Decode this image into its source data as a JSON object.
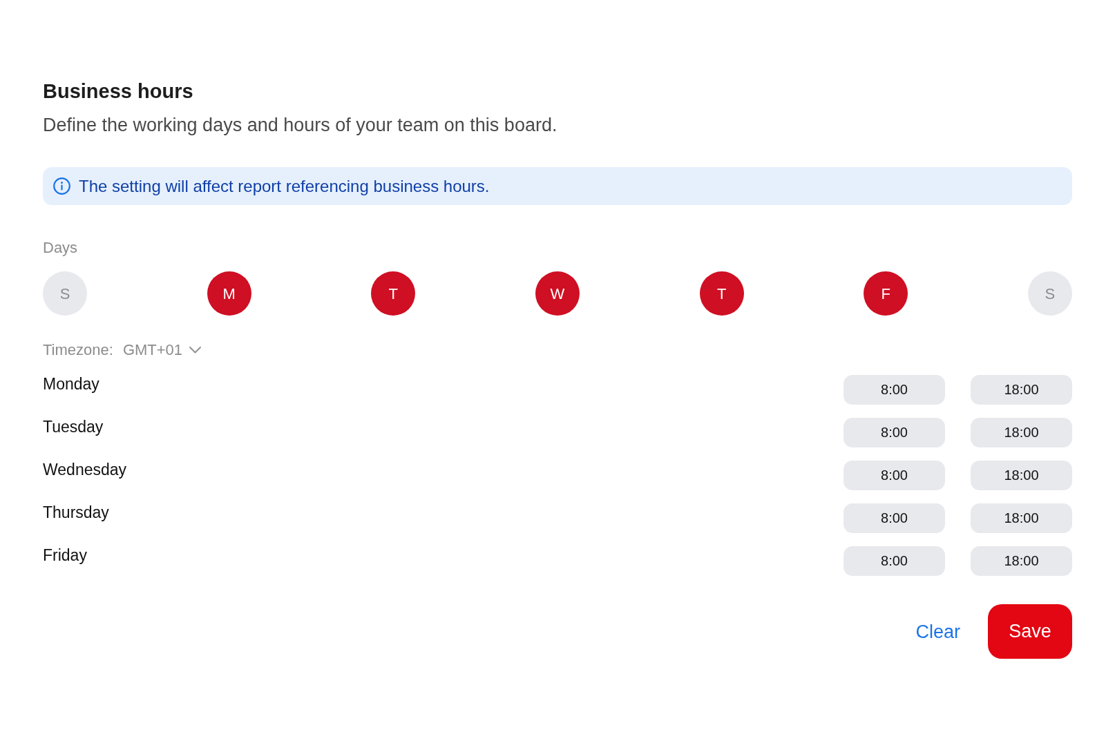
{
  "title": "Business hours",
  "subtitle": "Define the working days and hours of your team on this board.",
  "notice": {
    "text": "The setting will affect report referencing business hours."
  },
  "days": {
    "label": "Days",
    "items": [
      {
        "letter": "S",
        "selected": false
      },
      {
        "letter": "M",
        "selected": true
      },
      {
        "letter": "T",
        "selected": true
      },
      {
        "letter": "W",
        "selected": true
      },
      {
        "letter": "T",
        "selected": true
      },
      {
        "letter": "F",
        "selected": true
      },
      {
        "letter": "S",
        "selected": false
      }
    ]
  },
  "timezone": {
    "label": "Timezone:",
    "value": "GMT+01"
  },
  "schedule": [
    {
      "day": "Monday",
      "start": "8:00",
      "end": "18:00"
    },
    {
      "day": "Tuesday",
      "start": "8:00",
      "end": "18:00"
    },
    {
      "day": "Wednesday",
      "start": "8:00",
      "end": "18:00"
    },
    {
      "day": "Thursday",
      "start": "8:00",
      "end": "18:00"
    },
    {
      "day": "Friday",
      "start": "8:00",
      "end": "18:00"
    }
  ],
  "actions": {
    "clear": "Clear",
    "save": "Save"
  }
}
